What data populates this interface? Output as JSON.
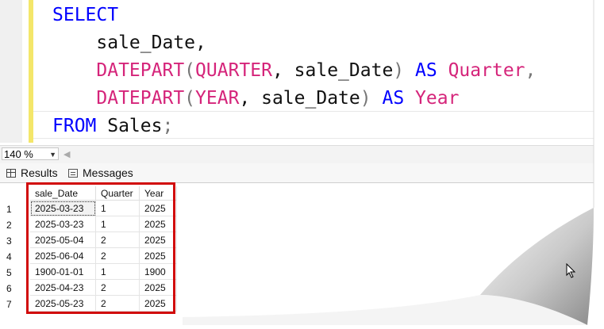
{
  "editor": {
    "lines": [
      [
        {
          "t": "SELECT",
          "c": "kw"
        }
      ],
      [
        {
          "t": "    sale_Date,",
          "c": "pl"
        }
      ],
      [
        {
          "t": "    ",
          "c": "pl"
        },
        {
          "t": "DATEPART",
          "c": "fn"
        },
        {
          "t": "(",
          "c": "gr"
        },
        {
          "t": "QUARTER",
          "c": "fn"
        },
        {
          "t": ", sale_Date",
          "c": "pl"
        },
        {
          "t": ")",
          "c": "gr"
        },
        {
          "t": " ",
          "c": "pl"
        },
        {
          "t": "AS",
          "c": "kw"
        },
        {
          "t": " ",
          "c": "pl"
        },
        {
          "t": "Quarter",
          "c": "fn"
        },
        {
          "t": ",",
          "c": "gr"
        }
      ],
      [
        {
          "t": "    ",
          "c": "pl"
        },
        {
          "t": "DATEPART",
          "c": "fn"
        },
        {
          "t": "(",
          "c": "gr"
        },
        {
          "t": "YEAR",
          "c": "fn"
        },
        {
          "t": ", sale_Date",
          "c": "pl"
        },
        {
          "t": ")",
          "c": "gr"
        },
        {
          "t": " ",
          "c": "pl"
        },
        {
          "t": "AS",
          "c": "kw"
        },
        {
          "t": " ",
          "c": "pl"
        },
        {
          "t": "Year",
          "c": "fn"
        }
      ],
      [
        {
          "t": "FROM",
          "c": "kw"
        },
        {
          "t": " Sales",
          "c": "pl"
        },
        {
          "t": ";",
          "c": "gr"
        }
      ]
    ]
  },
  "zoom": {
    "value": "140 %"
  },
  "tabs": {
    "results": "Results",
    "messages": "Messages"
  },
  "grid": {
    "columns": [
      "sale_Date",
      "Quarter",
      "Year"
    ],
    "rows": [
      {
        "n": "1",
        "date": "2025-03-23",
        "q": "1",
        "y": "2025"
      },
      {
        "n": "2",
        "date": "2025-03-23",
        "q": "1",
        "y": "2025"
      },
      {
        "n": "3",
        "date": "2025-05-04",
        "q": "2",
        "y": "2025"
      },
      {
        "n": "4",
        "date": "2025-06-04",
        "q": "2",
        "y": "2025"
      },
      {
        "n": "5",
        "date": "1900-01-01",
        "q": "1",
        "y": "1900"
      },
      {
        "n": "6",
        "date": "2025-04-23",
        "q": "2",
        "y": "2025"
      },
      {
        "n": "7",
        "date": "2025-05-23",
        "q": "2",
        "y": "2025"
      }
    ]
  },
  "colors": {
    "keyword": "#0000ff",
    "function": "#d5247a",
    "highlight": "#d10a0a"
  }
}
